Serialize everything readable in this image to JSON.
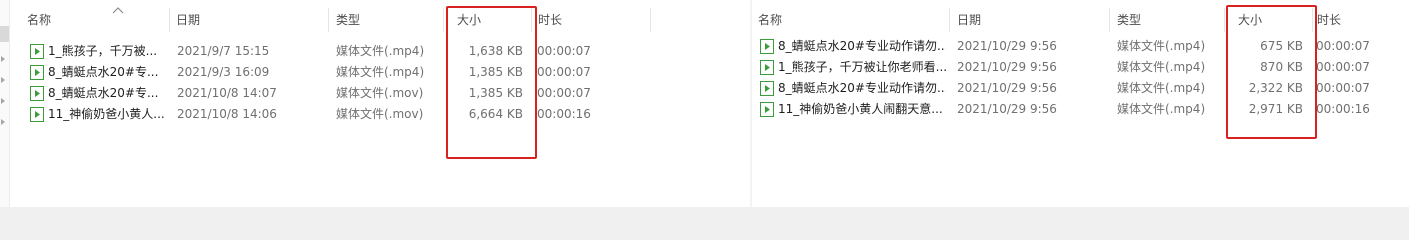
{
  "left": {
    "columns": {
      "name": "名称",
      "date": "日期",
      "type": "类型",
      "size": "大小",
      "duration": "时长"
    },
    "files": [
      {
        "name": "1_熊孩子，千万被...",
        "date": "2021/9/7 15:15",
        "type": "媒体文件(.mp4)",
        "size": "1,638 KB",
        "duration": "00:00:07"
      },
      {
        "name": "8_蜻蜓点水20#专...",
        "date": "2021/9/3 16:09",
        "type": "媒体文件(.mp4)",
        "size": "1,385 KB",
        "duration": "00:00:07"
      },
      {
        "name": "8_蜻蜓点水20#专...",
        "date": "2021/10/8 14:07",
        "type": "媒体文件(.mov)",
        "size": "1,385 KB",
        "duration": "00:00:07"
      },
      {
        "name": "11_神偷奶爸小黄人...",
        "date": "2021/10/8 14:06",
        "type": "媒体文件(.mov)",
        "size": "6,664 KB",
        "duration": "00:00:16"
      }
    ]
  },
  "right": {
    "columns": {
      "name": "名称",
      "date": "日期",
      "type": "类型",
      "size": "大小",
      "duration": "时长"
    },
    "files": [
      {
        "name": "8_蜻蜓点水20#专业动作请勿...",
        "date": "2021/10/29 9:56",
        "type": "媒体文件(.mp4)",
        "size": "675 KB",
        "duration": "00:00:07"
      },
      {
        "name": "1_熊孩子，千万被让你老师看...",
        "date": "2021/10/29 9:56",
        "type": "媒体文件(.mp4)",
        "size": "870 KB",
        "duration": "00:00:07"
      },
      {
        "name": "8_蜻蜓点水20#专业动作请勿...",
        "date": "2021/10/29 9:56",
        "type": "媒体文件(.mp4)",
        "size": "2,322 KB",
        "duration": "00:00:07"
      },
      {
        "name": "11_神偷奶爸小黄人闹翻天意...",
        "date": "2021/10/29 9:56",
        "type": "媒体文件(.mp4)",
        "size": "2,971 KB",
        "duration": "00:00:16"
      }
    ]
  },
  "icons": {
    "file": "video-file-icon",
    "sort": "sort-ascending-icon"
  },
  "colors": {
    "highlight": "#d9211f",
    "icon_green": "#3a9c3a"
  }
}
